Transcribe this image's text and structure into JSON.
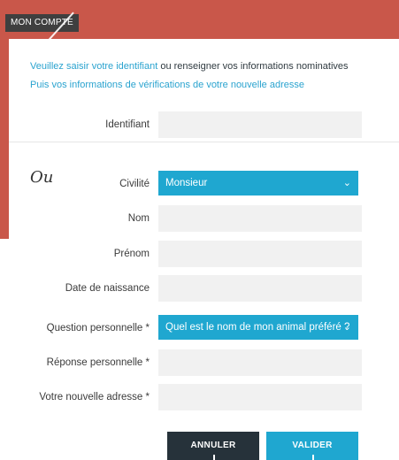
{
  "header": {
    "tab_label": "MON COMPTE"
  },
  "intro": {
    "line1_highlight": "Veuillez saisir votre identifiant",
    "line1_rest": " ou renseigner vos informations nominatives",
    "line2": "Puis vos informations de vérifications de votre nouvelle adresse"
  },
  "fields": {
    "identifiant_label": "Identifiant",
    "ou_text": "Ou",
    "civilite_label": "Civilité",
    "civilite_value": "Monsieur",
    "nom_label": "Nom",
    "prenom_label": "Prénom",
    "naissance_label": "Date de naissance",
    "question_label": "Question personnelle *",
    "question_value": "Quel est le nom de mon animal préféré ?",
    "reponse_label": "Réponse personnelle *",
    "adresse_label": "Votre nouvelle adresse *"
  },
  "buttons": {
    "cancel": "ANNULER",
    "submit": "VALIDER"
  },
  "colors": {
    "header": "#c9574a",
    "accent": "#1fa7d0",
    "dark_button": "#26323a"
  }
}
